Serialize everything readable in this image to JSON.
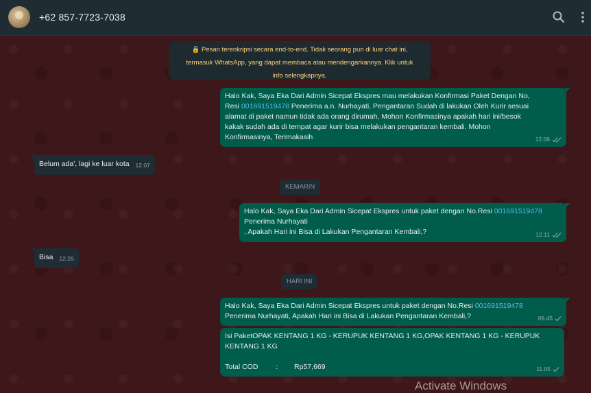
{
  "header": {
    "contact_name": "+62 857-7723-7038",
    "icons": [
      "search-icon",
      "menu-icon"
    ]
  },
  "system_notice": {
    "line1": "🔒 Pesan terenkripsi secara end-to-end. Tidak seorang pun di luar chat ini,",
    "line2": "termasuk WhatsApp, yang dapat membaca atau mendengarkannya. Klik untuk",
    "line3": "info selengkapnya."
  },
  "messages": {
    "m1": {
      "l1": "Halo Kak, Saya Eka Dari Admin Sicepat Ekspres mau melakukan Konfirmasi Paket Dengan No,",
      "l2a": "Resi ",
      "l2link": "001691519478",
      "l2b": " Penerima a.n. Nurhayati, Pengantaran Sudah di lakukan Oleh Kurir sesuai",
      "l3": "alamat di paket namun tidak ada orang dirumah, Mohon Konfirmasinya apakah hari ini/besok",
      "l4": "kakak sudah ada di tempat agar kurir bisa melakukan pengantaran kembali. Mohon",
      "l5": "Konfirmasinya, Terimakasih",
      "time": "12.06"
    },
    "m2": {
      "text": "Belum ada', lagi ke luar kota",
      "time": "12.07"
    },
    "date1": "KEMARIN",
    "m3": {
      "l1a": "Halo Kak, Saya Eka Dari Admin Sicepat Ekspres untuk paket dengan No.Resi ",
      "l1link": "001691519478",
      "l2": " Penerima Nurhayati",
      "l3": ", Apakah Hari ini Bisa di Lakukan Pengantaran Kembali,?",
      "time": "12.11"
    },
    "m4": {
      "text": "Bisa",
      "time": "12.26"
    },
    "date2": "HARI INI",
    "m5": {
      "l1a": "Halo Kak, Saya Eka Dari Admin Sicepat Ekspres untuk paket dengan No.Resi ",
      "l1link": "001691519478",
      "l2": "Penerima Nurhayati, Apakah Hari ini Bisa di Lakukan Pengantaran Kembali,?",
      "time": "09.45"
    },
    "m6": {
      "l1": "Isi PaketOPAK KENTANG 1 KG - KERUPUK KENTANG 1 KG,OPAK KENTANG 1 KG - KERUPUK",
      "l2": "KENTANG 1 KG",
      "cod_label": "Total COD",
      "cod_sep": ":",
      "cod_value": "Rp57,669",
      "time": "11.05"
    }
  },
  "watermark": "Activate Windows",
  "colors": {
    "outgoing": "#005c4b",
    "incoming": "#1f2c33",
    "link": "#53bdeb",
    "notice_text": "#ffd279",
    "chat_bg": "#3d1719"
  }
}
